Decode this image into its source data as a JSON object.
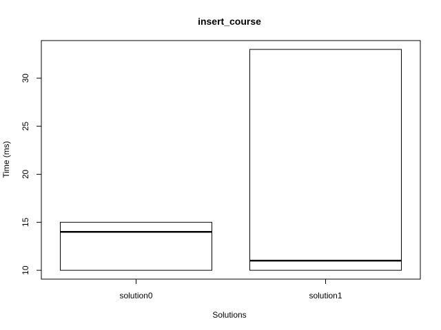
{
  "chart_data": {
    "type": "box",
    "title": "insert_course",
    "xlabel": "Solutions",
    "ylabel": "Time (ms)",
    "categories": [
      "solution0",
      "solution1"
    ],
    "boxes": [
      {
        "category": "solution0",
        "lower": 10,
        "median": 14,
        "upper": 15
      },
      {
        "category": "solution1",
        "lower": 10,
        "median": 11,
        "upper": 33
      }
    ],
    "yticks": [
      10,
      15,
      20,
      25,
      30
    ],
    "ylim": [
      9.08,
      33.92
    ],
    "grid": false,
    "legend": "none"
  }
}
